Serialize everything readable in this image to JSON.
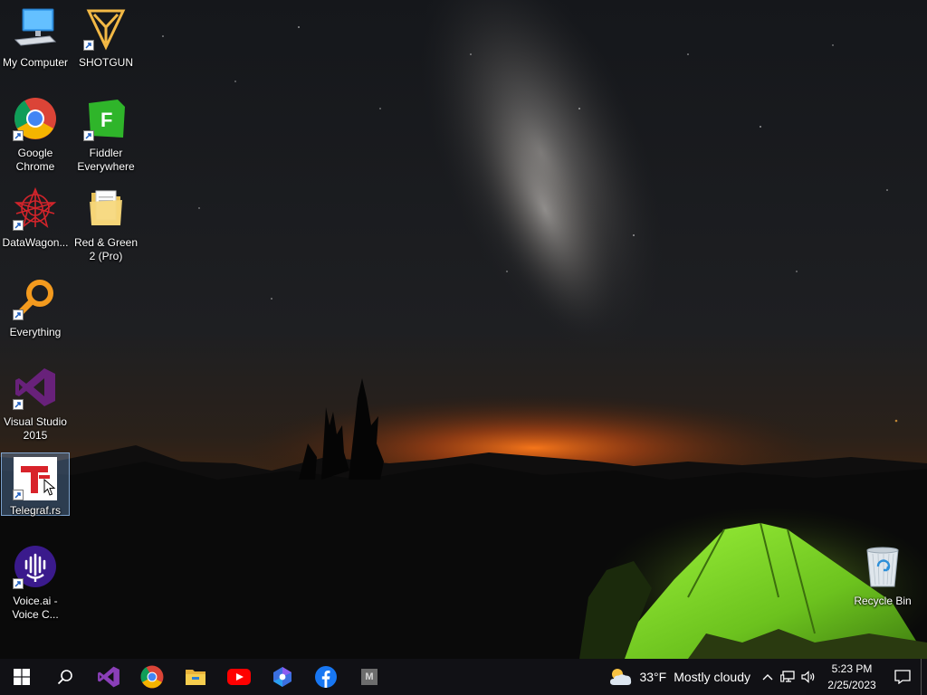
{
  "desktop": {
    "icons": [
      {
        "label": "My Computer",
        "icon": "computer-icon"
      },
      {
        "label": "SHOTGUN",
        "icon": "shotgun-icon"
      },
      {
        "label": "Google\nChrome",
        "icon": "chrome-icon"
      },
      {
        "label": "Fiddler\nEverywhere",
        "icon": "fiddler-icon"
      },
      {
        "label": "DataWagon...",
        "icon": "datawagon-icon"
      },
      {
        "label": "Red & Green\n2 (Pro)",
        "icon": "folder-icon"
      },
      {
        "label": "Everything",
        "icon": "everything-icon"
      },
      {
        "label": "Visual Studio\n2015",
        "icon": "visual-studio-icon"
      },
      {
        "label": "Telegraf.rs",
        "icon": "telegraf-icon",
        "selected": true
      },
      {
        "label": "Voice.ai -\nVoice C...",
        "icon": "voiceai-icon"
      },
      {
        "label": "Recycle Bin",
        "icon": "recycle-bin-icon"
      }
    ]
  },
  "taskbar": {
    "pinned": [
      "start-icon",
      "search-icon",
      "visual-studio-icon",
      "chrome-icon",
      "file-explorer-icon",
      "youtube-icon",
      "copilot-icon",
      "facebook-icon",
      "m-app-icon"
    ],
    "m_app_letter": "M",
    "weather": {
      "temp": "33°F",
      "condition": "Mostly cloudy",
      "icon": "cloud-sun-icon"
    },
    "clock": {
      "time": "5:23 PM",
      "date": "2/25/2023"
    }
  },
  "colors": {
    "taskbar": "#121216",
    "selection": "#78aae6",
    "tent": "#7cd62a"
  }
}
